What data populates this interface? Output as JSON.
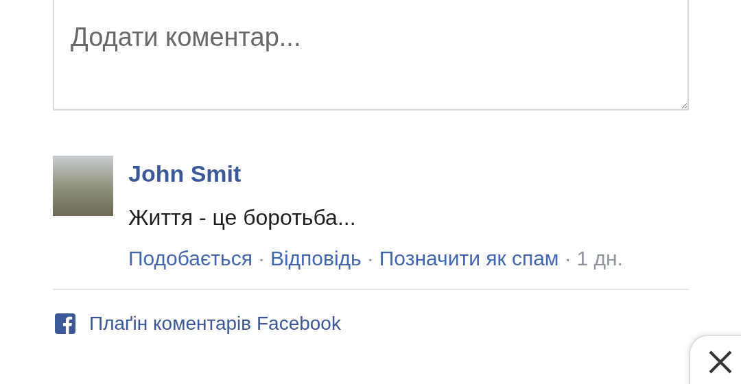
{
  "comment_box": {
    "placeholder": "Додати коментар..."
  },
  "comments": [
    {
      "author": "John Smit",
      "text": "Життя - це боротьба...",
      "actions": [
        {
          "kind": "link",
          "label": "Подобається"
        },
        {
          "kind": "separator",
          "label": "·"
        },
        {
          "kind": "link",
          "label": "Відповідь"
        },
        {
          "kind": "separator",
          "label": "·"
        },
        {
          "kind": "link",
          "label": "Позначити як спам"
        },
        {
          "kind": "separator",
          "label": "·"
        },
        {
          "kind": "time",
          "label": "1 дн."
        }
      ]
    }
  ],
  "footer": {
    "label": "Плаґін коментарів Facebook"
  }
}
